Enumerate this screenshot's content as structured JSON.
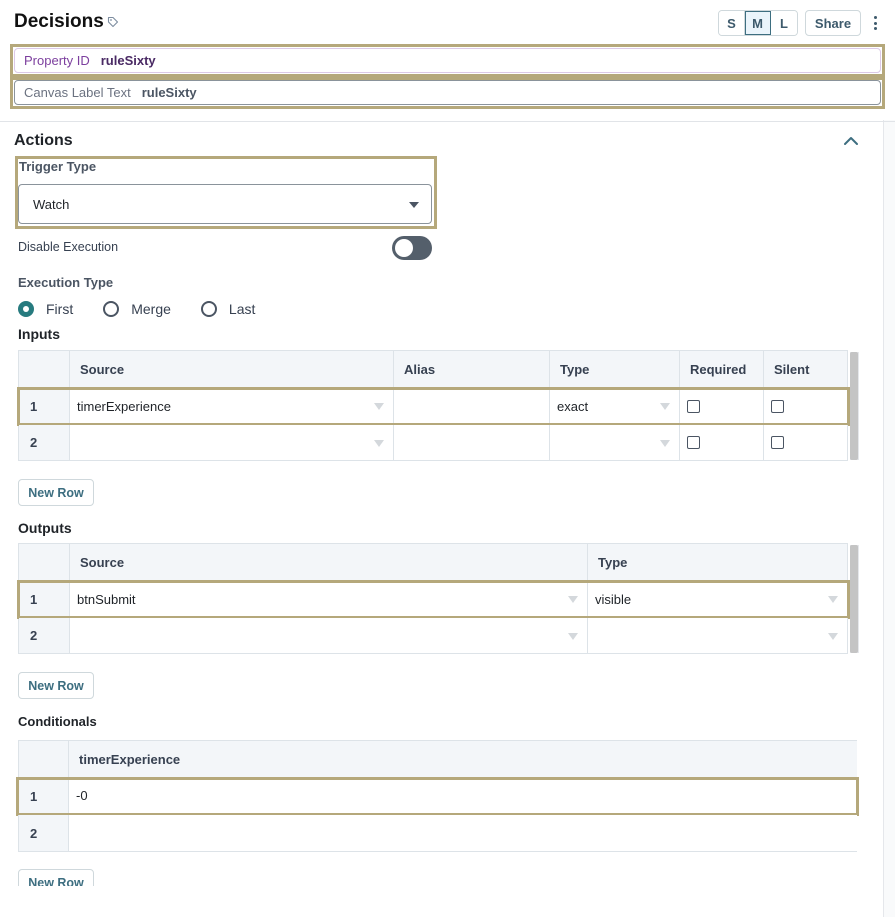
{
  "header": {
    "title": "Decisions",
    "tag_icon": "tag-icon",
    "sizes": [
      "S",
      "M",
      "L"
    ],
    "active_size": "M",
    "share_label": "Share",
    "more_icon": "kebab-menu-icon"
  },
  "properties": {
    "property_id_label": "Property ID",
    "property_id_value": "ruleSixty",
    "canvas_label_label": "Canvas Label Text",
    "canvas_label_value": "ruleSixty"
  },
  "actions": {
    "title": "Actions",
    "collapse_icon": "chevron-up-icon",
    "trigger_type_label": "Trigger Type",
    "trigger_type_value": "Watch",
    "disable_execution_label": "Disable Execution",
    "disable_execution_on": false,
    "execution_type_label": "Execution Type",
    "execution_options": [
      "First",
      "Merge",
      "Last"
    ],
    "execution_selected": "First"
  },
  "inputs": {
    "title": "Inputs",
    "columns": [
      "",
      "Source",
      "Alias",
      "Type",
      "Required",
      "Silent"
    ],
    "rows": [
      {
        "num": "1",
        "source": "timerExperience",
        "alias": "",
        "type": "exact",
        "required": false,
        "silent": false
      },
      {
        "num": "2",
        "source": "",
        "alias": "",
        "type": "",
        "required": false,
        "silent": false
      }
    ],
    "new_row_label": "New Row"
  },
  "outputs": {
    "title": "Outputs",
    "columns": [
      "",
      "Source",
      "Type"
    ],
    "rows": [
      {
        "num": "1",
        "source": "btnSubmit",
        "type": "visible"
      },
      {
        "num": "2",
        "source": "",
        "type": ""
      }
    ],
    "new_row_label": "New Row"
  },
  "conditionals": {
    "title": "Conditionals",
    "columns": [
      "",
      "timerExperience"
    ],
    "rows": [
      {
        "num": "1",
        "value": "-0"
      },
      {
        "num": "2",
        "value": ""
      }
    ],
    "new_row_label": "New Row"
  },
  "colors": {
    "highlight": "#b5a87b",
    "accent": "#277b7f",
    "property_purple": "#7c3f9e"
  }
}
